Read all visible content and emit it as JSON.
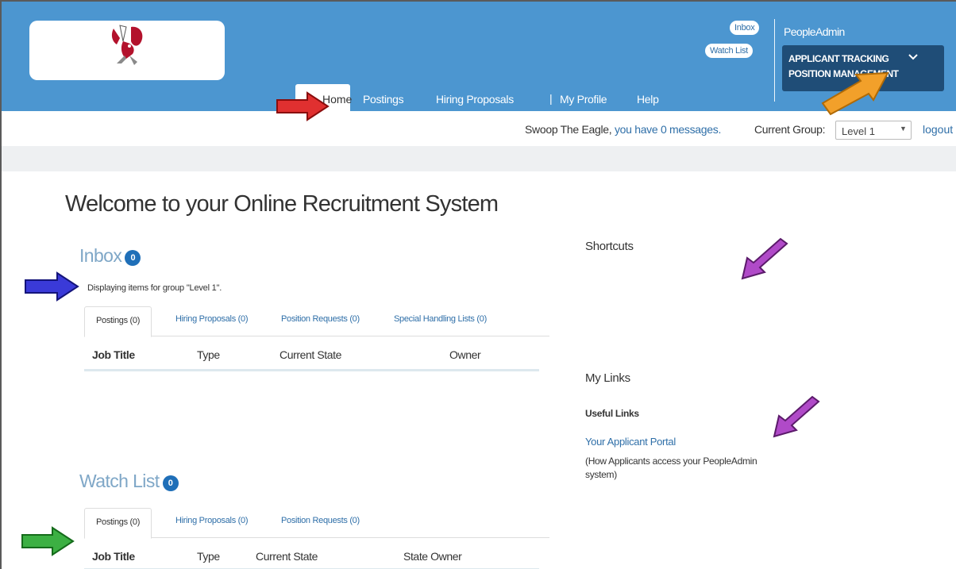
{
  "header": {
    "inbox_pill": "Inbox",
    "watch_pill": "Watch List",
    "brand": "PeopleAdmin",
    "app_menu": [
      "APPLICANT TRACKING",
      "POSITION MANAGEMENT"
    ],
    "nav": {
      "home": "Home",
      "postings": "Postings",
      "hiring": "Hiring Proposals",
      "divider": "|",
      "profile": "My Profile",
      "help": "Help"
    }
  },
  "userbar": {
    "greeting_prefix": "Swoop The Eagle, ",
    "messages_link": "you have 0 messages.",
    "group_label": "Current Group:",
    "group_value": "Level 1",
    "logout": "logout"
  },
  "main": {
    "welcome": "Welcome to your Online Recruitment System",
    "inbox": {
      "title": "Inbox",
      "count": "0",
      "note": "Displaying items for group \"Level 1\".",
      "tabs": [
        "Postings (0)",
        "Hiring Proposals (0)",
        "Position Requests (0)",
        "Special Handling Lists (0)"
      ],
      "columns": [
        "Job Title",
        "Type",
        "Current State",
        "Owner"
      ]
    },
    "watch": {
      "title": "Watch List",
      "count": "0",
      "tabs": [
        "Postings (0)",
        "Hiring Proposals (0)",
        "Position Requests (0)"
      ],
      "columns": [
        "Job Title",
        "Type",
        "Current State",
        "State Owner"
      ]
    }
  },
  "sidebar": {
    "shortcuts": "Shortcuts",
    "my_links": "My Links",
    "useful_links": "Useful Links",
    "portal_link": "Your Applicant Portal",
    "portal_desc": "(How Applicants access your PeopleAdmin system)"
  },
  "colors": {
    "header_bg": "#4c96d0",
    "menu_bg": "#1f4d77",
    "link": "#2f6fa8",
    "arrow_red": "#e03030",
    "arrow_blue": "#3a3ad8",
    "arrow_green": "#3cb043",
    "arrow_purple": "#b04ac8",
    "arrow_orange": "#f2a02a"
  }
}
